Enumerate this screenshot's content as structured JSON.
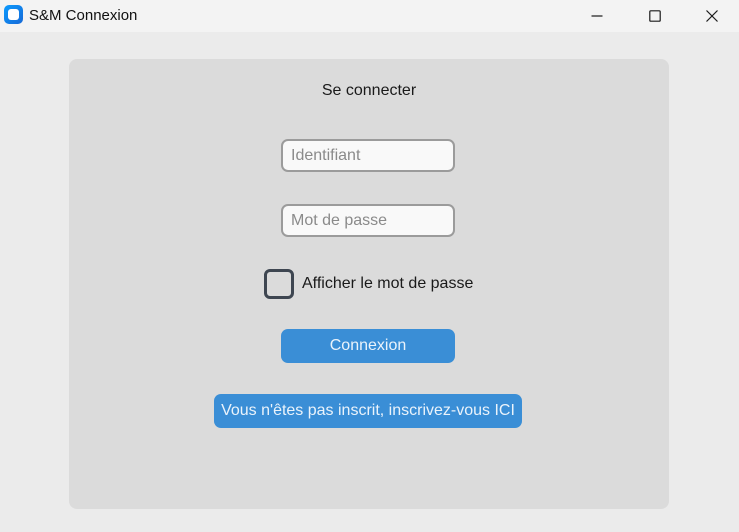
{
  "window": {
    "title": "S&M Connexion",
    "icon": "app-icon"
  },
  "titlebar_controls": {
    "minimize_icon": "minimize-icon",
    "maximize_icon": "maximize-icon",
    "close_icon": "close-icon"
  },
  "login": {
    "heading": "Se connecter",
    "username": {
      "value": "",
      "placeholder": "Identifiant"
    },
    "password": {
      "value": "",
      "placeholder": "Mot de passe"
    },
    "show_password": {
      "label": "Afficher le mot de passe",
      "checked": false
    },
    "submit_label": "Connexion",
    "register_label": "Vous n'êtes pas inscrit, inscrivez-vous ICI"
  },
  "colors": {
    "window_bg": "#ebebeb",
    "card_bg": "#dbdbdb",
    "button_bg": "#3a8ed6",
    "button_text": "#eaf3fb",
    "checkbox_border": "#3e4651"
  }
}
